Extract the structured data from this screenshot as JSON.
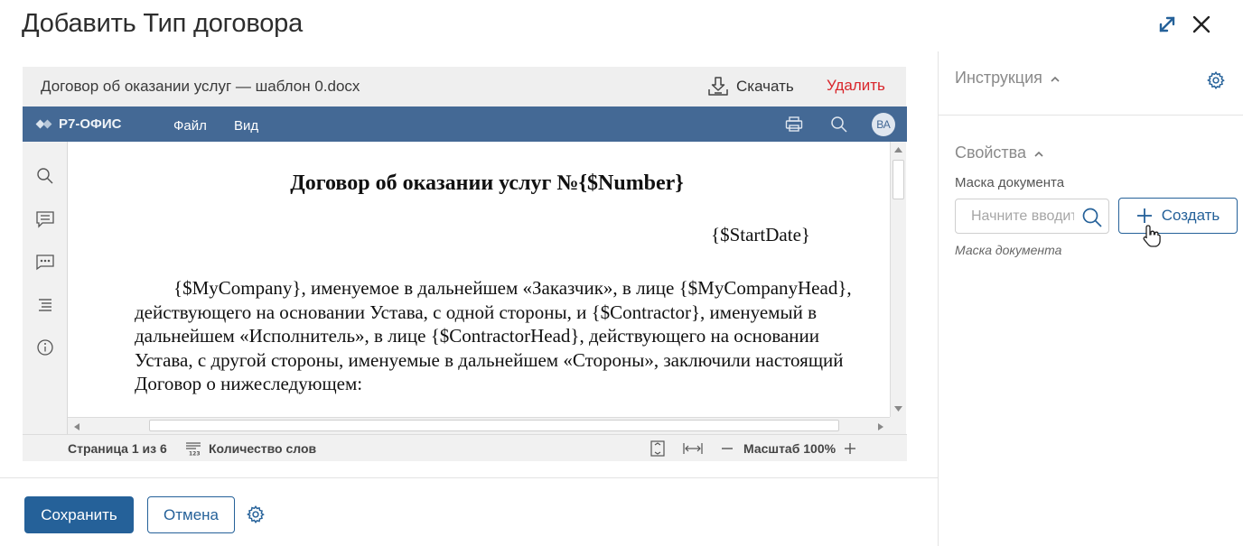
{
  "dialog": {
    "title": "Добавить Тип договора"
  },
  "file_bar": {
    "filename": "Договор об оказании услуг — шаблон 0.docx",
    "download_label": "Скачать",
    "delete_label": "Удалить"
  },
  "editor": {
    "logo_text": "Р7-ОФИС",
    "menu": [
      "Файл",
      "Вид"
    ],
    "avatar_initials": "ВА",
    "toolbar_color": "#446995"
  },
  "document": {
    "title": "Договор об оказании услуг №{$Number}",
    "date": "{$StartDate}",
    "paragraph": "{$MyCompany}, именуемое в дальнейшем «Заказчик», в лице {$MyCompanyHead}, действующего на основании Устава, с одной стороны, и {$Contractor}, именуемый в дальнейшем «Исполнитель», в лице {$ContractorHead}, действующего на основании Устава, с другой стороны, именуемые в дальнейшем «Стороны», заключили настоящий Договор о нижеследующем:"
  },
  "status_bar": {
    "page_info": "Страница 1 из 6",
    "word_count_label": "Количество слов",
    "zoom_label": "Масштаб 100%"
  },
  "footer": {
    "save_label": "Сохранить",
    "cancel_label": "Отмена"
  },
  "right_panel": {
    "instruction_title": "Инструкция",
    "properties_title": "Свойства",
    "mask_label": "Маска документа",
    "mask_placeholder": "Начните вводить",
    "create_label": "Создать",
    "mask_hint": "Маска документа"
  },
  "colors": {
    "primary": "#256199",
    "danger": "#d9262b"
  }
}
